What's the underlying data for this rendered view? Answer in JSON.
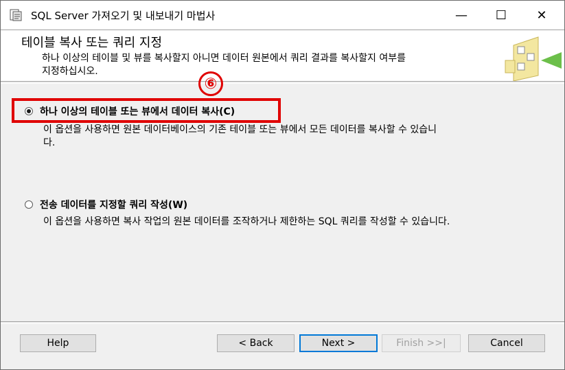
{
  "window": {
    "title": "SQL Server 가져오기 및 내보내기 마법사",
    "controls": {
      "minimize": "—",
      "maximize": "☐",
      "close": "✕"
    }
  },
  "header": {
    "title": "테이블 복사 또는 쿼리 지정",
    "description_line1": "하나 이상의 테이블 및 뷰를 복사할지 아니면 데이터 원본에서 쿼리 결과를 복사할지 여부를",
    "description_line2": "지정하십시오."
  },
  "annotation": {
    "step_badge": "⑥",
    "color": "#e00000"
  },
  "options": [
    {
      "label": "하나 이상의 테이블 또는 뷰에서 데이터 복사(C)",
      "description_line1": "이 옵션을 사용하면 원본 데이터베이스의 기존 테이블 또는 뷰에서 모든 데이터를 복사할 수 있습니",
      "description_line2": "다.",
      "selected": true
    },
    {
      "label": "전송 데이터를 지정할 쿼리 작성(W)",
      "description_line1": "이 옵션을 사용하면 복사 작업의 원본 데이터를 조작하거나 제한하는 SQL 쿼리를 작성할 수 있습니다.",
      "selected": false
    }
  ],
  "buttons": {
    "help": "Help",
    "back": "< Back",
    "next": "Next >",
    "finish": "Finish >>|",
    "cancel": "Cancel"
  }
}
